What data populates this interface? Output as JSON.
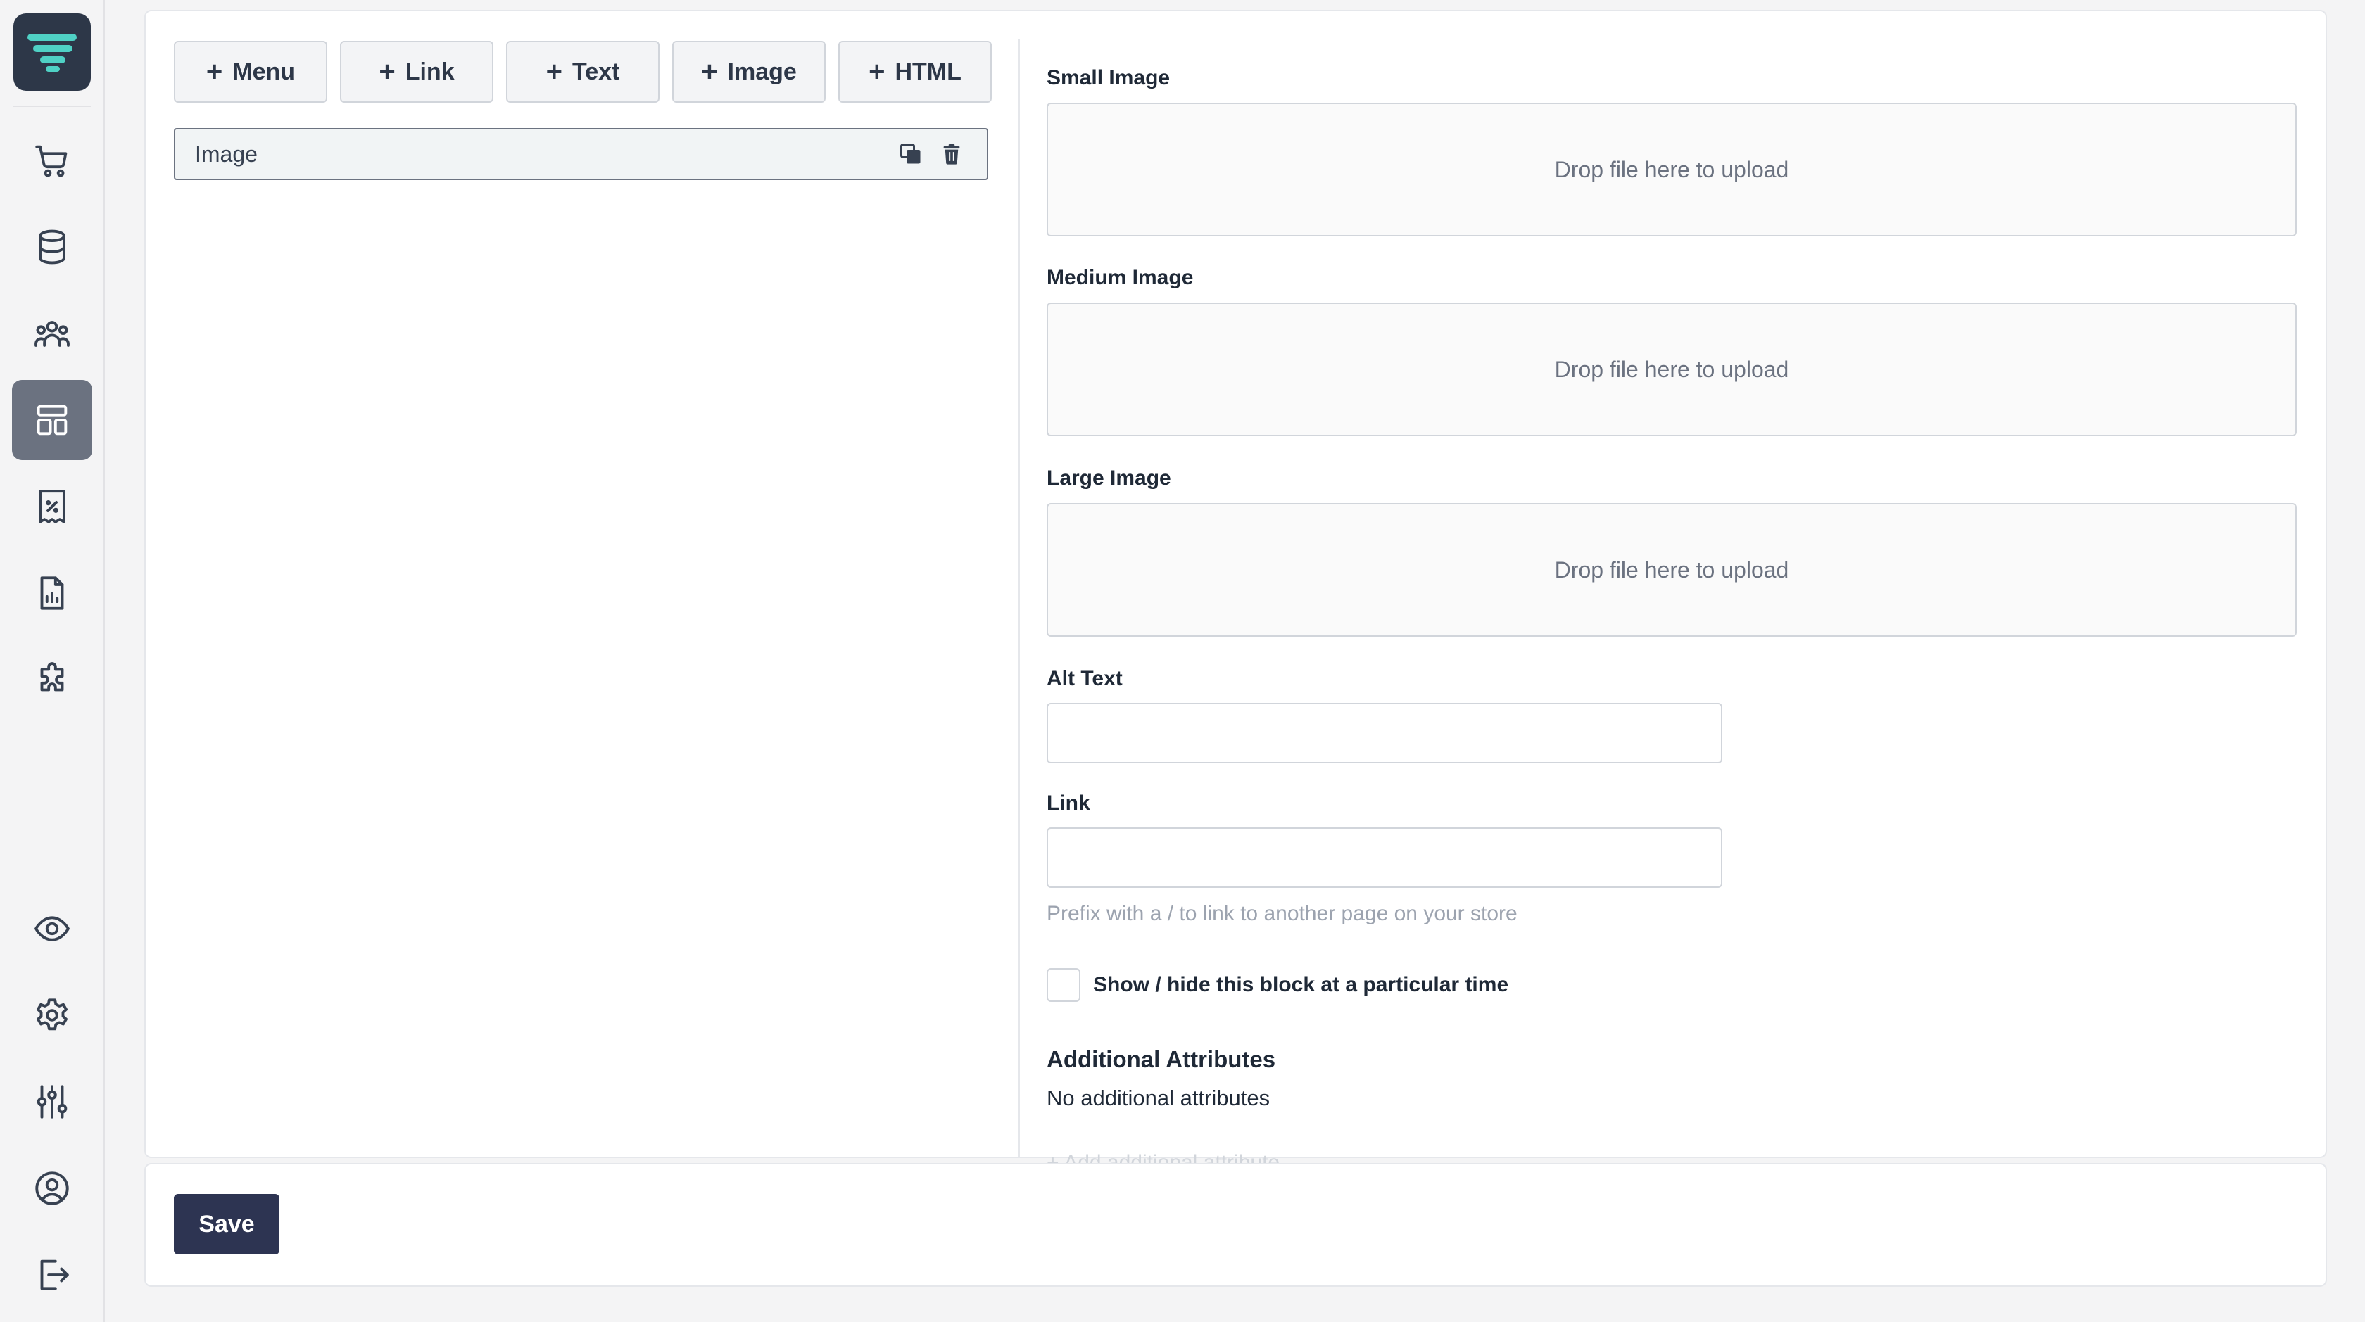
{
  "sidebar": {
    "logo": "logo-icon",
    "items": [
      {
        "name": "cart-icon"
      },
      {
        "name": "database-icon"
      },
      {
        "name": "users-icon"
      },
      {
        "name": "layout-icon",
        "active": true
      },
      {
        "name": "discount-receipt-icon"
      },
      {
        "name": "report-icon"
      },
      {
        "name": "puzzle-icon"
      },
      {
        "name": "eye-icon"
      },
      {
        "name": "gear-icon"
      },
      {
        "name": "sliders-icon"
      },
      {
        "name": "user-circle-icon"
      },
      {
        "name": "logout-icon"
      }
    ]
  },
  "toolbar": {
    "menu_label": "Menu",
    "link_label": "Link",
    "text_label": "Text",
    "image_label": "Image",
    "html_label": "HTML"
  },
  "blocks": [
    {
      "label": "Image"
    }
  ],
  "form": {
    "small_image_label": "Small Image",
    "medium_image_label": "Medium Image",
    "large_image_label": "Large Image",
    "drop_text": "Drop file here to upload",
    "alt_text_label": "Alt Text",
    "alt_text_value": "",
    "link_label": "Link",
    "link_value": "",
    "link_help": "Prefix with a / to link to another page on your store",
    "schedule_label": "Show / hide this block at a particular time",
    "additional_title": "Additional Attributes",
    "additional_empty": "No additional attributes",
    "add_attribute_partial": "+ Add additional attribute"
  },
  "footer": {
    "save_label": "Save"
  },
  "colors": {
    "logo_bg": "#2d3748",
    "logo_accent": "#4fd1c5",
    "save_bg": "#2d3452",
    "active_nav": "#6b7280"
  }
}
